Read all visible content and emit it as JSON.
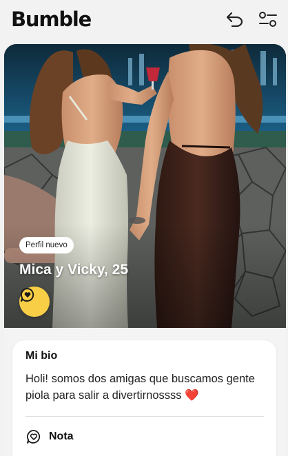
{
  "header": {
    "logo": "Bumble",
    "undo_icon": "undo-arrow-icon",
    "filter_icon": "filter-sliders-icon"
  },
  "profile": {
    "badge": "Perfil nuevo",
    "name_age": "Mica y Vicky, 25",
    "compliment_icon": "heart-speech-bubble-icon"
  },
  "bio": {
    "title": "Mi bio",
    "text": "Holi! somos dos amigas que buscamos gente piola para salir a divertirnossss ❤️",
    "note_label": "Nota",
    "note_icon": "heart-speech-bubble-icon"
  },
  "colors": {
    "accent_yellow": "#f8ce46",
    "background": "#f2f2f2"
  }
}
